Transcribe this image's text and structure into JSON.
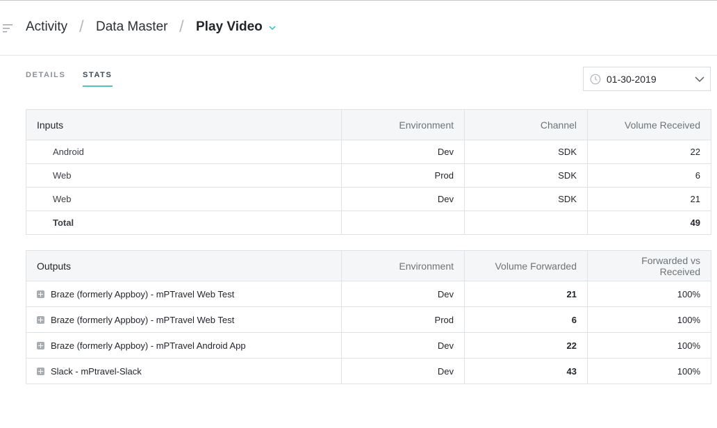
{
  "breadcrumb": {
    "item1": "Activity",
    "item2": "Data Master",
    "current": "Play Video"
  },
  "tabs": {
    "details": "DETAILS",
    "stats": "STATS"
  },
  "date_picker": {
    "value": "01-30-2019"
  },
  "inputs": {
    "headers": [
      "Inputs",
      "Environment",
      "Channel",
      "Volume Received"
    ],
    "rows": [
      [
        "Android",
        "Dev",
        "SDK",
        "22"
      ],
      [
        "Web",
        "Prod",
        "SDK",
        "6"
      ],
      [
        "Web",
        "Dev",
        "SDK",
        "21"
      ]
    ],
    "total_label": "Total",
    "total_value": "49"
  },
  "outputs": {
    "headers": [
      "Outputs",
      "Environment",
      "Volume Forwarded",
      "Forwarded vs Received"
    ],
    "rows": [
      [
        "Braze (formerly Appboy) - mPTravel Web Test",
        "Dev",
        "21",
        "100%"
      ],
      [
        "Braze (formerly Appboy) - mPTravel Web Test",
        "Prod",
        "6",
        "100%"
      ],
      [
        "Braze (formerly Appboy) - mPTravel Android App",
        "Dev",
        "22",
        "100%"
      ],
      [
        "Slack - mPtravel-Slack",
        "Dev",
        "43",
        "100%"
      ]
    ]
  },
  "colors": {
    "accent": "#4fc3c3",
    "header_bg": "#f5f6f7",
    "border": "#e0e3e5"
  }
}
